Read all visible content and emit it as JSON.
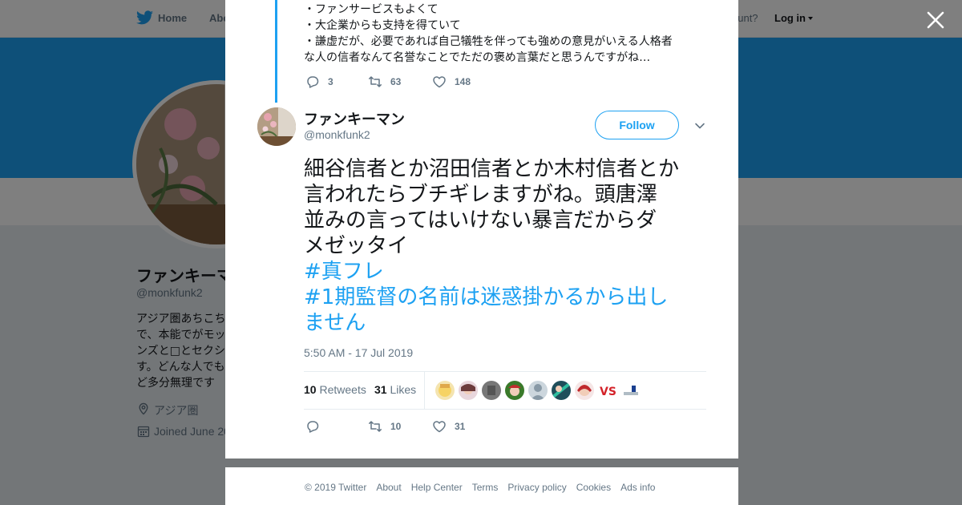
{
  "nav": {
    "home_label": "Home",
    "about_label": "Abo",
    "account_text": "ccount?",
    "login_label": "Log in"
  },
  "profile": {
    "name": "ファンキーマ",
    "handle": "@monkfunk2",
    "bio_lines": [
      "アジア圏あちこち",
      "で、本能でがモッ",
      "ンズと□とセクシ",
      "す。どんな人でも",
      "ど多分無理です"
    ],
    "location": "アジア圏",
    "joined": "Joined June 20"
  },
  "previous_tweet": {
    "lines": [
      "・ファンサービスもよくて",
      "・大企業からも支持を得ていて",
      "・謙虚だが、必要であれば自己犠牲を伴っても強めの意見がいえる人格者",
      "な人の信者なんて名誉なことでただの褒め言葉だと思うんですがね…"
    ],
    "reply_count": "3",
    "retweet_count": "63",
    "like_count": "148"
  },
  "tweet": {
    "author_name": "ファンキーマン",
    "author_handle": "@monkfunk2",
    "follow_label": "Follow",
    "text_lines": [
      "細谷信者とか沼田信者とか木村信者とか",
      "言われたらブチギレますがね。頭唐澤",
      "並みの言ってはいけない暴言だからダ",
      "メゼッタイ"
    ],
    "hashtag1": "#真フレ",
    "hashtag2_lines": [
      "#1期監督の名前は迷惑掛かるから出し",
      "ません"
    ],
    "timestamp": "5:50 AM - 17 Jul 2019",
    "retweets_count": "10",
    "retweets_label": "Retweets",
    "likes_count": "31",
    "likes_label": "Likes",
    "action_retweet_count": "10",
    "action_like_count": "31"
  },
  "footer": {
    "copyright": "© 2019 Twitter",
    "links": [
      "About",
      "Help Center",
      "Terms",
      "Privacy policy",
      "Cookies",
      "Ads info"
    ]
  },
  "colors": {
    "accent": "#1da1f2",
    "text": "#14171a",
    "muted": "#657786",
    "border": "#e6ecf0"
  },
  "icons": [
    "twitter-bird-icon",
    "caret-down-icon",
    "close-icon",
    "reply-icon",
    "retweet-icon",
    "like-icon",
    "chevron-down-icon",
    "location-icon",
    "calendar-icon"
  ]
}
